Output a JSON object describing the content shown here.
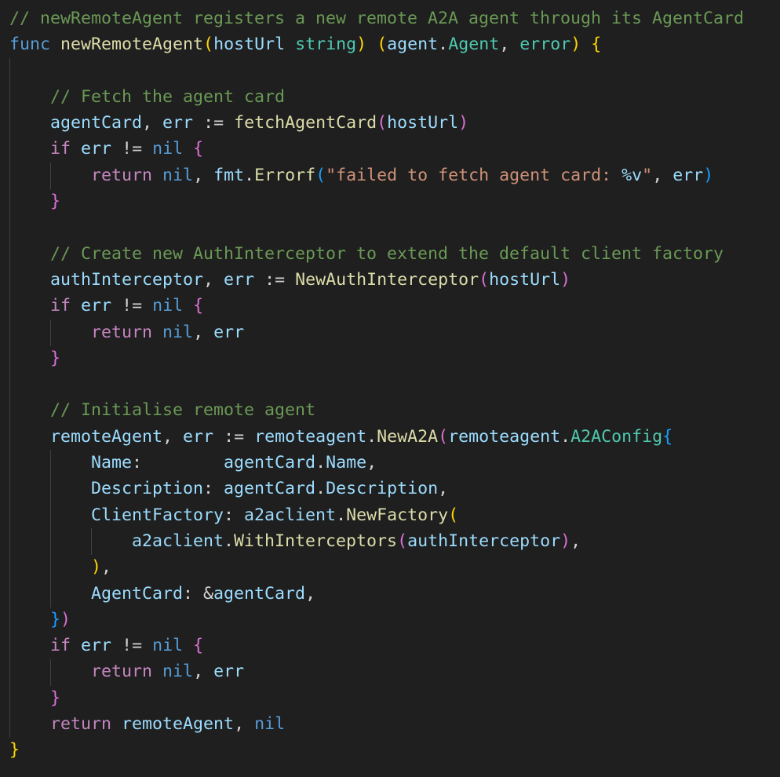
{
  "editor": {
    "theme_colors": {
      "background": "#1f1f1f",
      "comment": "#6a9955",
      "keyword": "#569cd6",
      "control": "#c586c0",
      "function": "#dcdcaa",
      "variable": "#9cdcfe",
      "type": "#4ec9b0",
      "string": "#ce9178",
      "format_specifier": "#9cdcfe",
      "plain": "#d4d4d4",
      "bracket_gold": "#ffd700",
      "bracket_purple": "#da70d6",
      "bracket_blue": "#179fff",
      "indent_guide": "#404040"
    },
    "lines": [
      [
        [
          "comment",
          "// newRemoteAgent registers a new remote A2A agent through its AgentCard"
        ]
      ],
      [
        [
          "keyword",
          "func"
        ],
        [
          "plain",
          " "
        ],
        [
          "function",
          "newRemoteAgent"
        ],
        [
          "bracket_gold",
          "("
        ],
        [
          "variable",
          "hostUrl"
        ],
        [
          "plain",
          " "
        ],
        [
          "type",
          "string"
        ],
        [
          "bracket_gold",
          ")"
        ],
        [
          "plain",
          " "
        ],
        [
          "bracket_gold",
          "("
        ],
        [
          "variable",
          "agent"
        ],
        [
          "plain",
          "."
        ],
        [
          "type",
          "Agent"
        ],
        [
          "plain",
          ", "
        ],
        [
          "type",
          "error"
        ],
        [
          "bracket_gold",
          ")"
        ],
        [
          "plain",
          " "
        ],
        [
          "bracket_gold",
          "{"
        ]
      ],
      [],
      [
        [
          "plain",
          "    "
        ],
        [
          "comment",
          "// Fetch the agent card"
        ]
      ],
      [
        [
          "plain",
          "    "
        ],
        [
          "variable",
          "agentCard"
        ],
        [
          "plain",
          ", "
        ],
        [
          "variable",
          "err"
        ],
        [
          "plain",
          " := "
        ],
        [
          "function",
          "fetchAgentCard"
        ],
        [
          "bracket_purple",
          "("
        ],
        [
          "variable",
          "hostUrl"
        ],
        [
          "bracket_purple",
          ")"
        ]
      ],
      [
        [
          "plain",
          "    "
        ],
        [
          "control",
          "if"
        ],
        [
          "plain",
          " "
        ],
        [
          "variable",
          "err"
        ],
        [
          "plain",
          " != "
        ],
        [
          "keyword",
          "nil"
        ],
        [
          "plain",
          " "
        ],
        [
          "bracket_purple",
          "{"
        ]
      ],
      [
        [
          "plain",
          "        "
        ],
        [
          "control",
          "return"
        ],
        [
          "plain",
          " "
        ],
        [
          "keyword",
          "nil"
        ],
        [
          "plain",
          ", "
        ],
        [
          "variable",
          "fmt"
        ],
        [
          "plain",
          "."
        ],
        [
          "function",
          "Errorf"
        ],
        [
          "bracket_blue",
          "("
        ],
        [
          "string",
          "\"failed to fetch agent card: "
        ],
        [
          "format_specifier",
          "%v"
        ],
        [
          "string",
          "\""
        ],
        [
          "plain",
          ", "
        ],
        [
          "variable",
          "err"
        ],
        [
          "bracket_blue",
          ")"
        ]
      ],
      [
        [
          "plain",
          "    "
        ],
        [
          "bracket_purple",
          "}"
        ]
      ],
      [],
      [
        [
          "plain",
          "    "
        ],
        [
          "comment",
          "// Create new AuthInterceptor to extend the default client factory"
        ]
      ],
      [
        [
          "plain",
          "    "
        ],
        [
          "variable",
          "authInterceptor"
        ],
        [
          "plain",
          ", "
        ],
        [
          "variable",
          "err"
        ],
        [
          "plain",
          " := "
        ],
        [
          "function",
          "NewAuthInterceptor"
        ],
        [
          "bracket_purple",
          "("
        ],
        [
          "variable",
          "hostUrl"
        ],
        [
          "bracket_purple",
          ")"
        ]
      ],
      [
        [
          "plain",
          "    "
        ],
        [
          "control",
          "if"
        ],
        [
          "plain",
          " "
        ],
        [
          "variable",
          "err"
        ],
        [
          "plain",
          " != "
        ],
        [
          "keyword",
          "nil"
        ],
        [
          "plain",
          " "
        ],
        [
          "bracket_purple",
          "{"
        ]
      ],
      [
        [
          "plain",
          "        "
        ],
        [
          "control",
          "return"
        ],
        [
          "plain",
          " "
        ],
        [
          "keyword",
          "nil"
        ],
        [
          "plain",
          ", "
        ],
        [
          "variable",
          "err"
        ]
      ],
      [
        [
          "plain",
          "    "
        ],
        [
          "bracket_purple",
          "}"
        ]
      ],
      [],
      [
        [
          "plain",
          "    "
        ],
        [
          "comment",
          "// Initialise remote agent"
        ]
      ],
      [
        [
          "plain",
          "    "
        ],
        [
          "variable",
          "remoteAgent"
        ],
        [
          "plain",
          ", "
        ],
        [
          "variable",
          "err"
        ],
        [
          "plain",
          " := "
        ],
        [
          "variable",
          "remoteagent"
        ],
        [
          "plain",
          "."
        ],
        [
          "function",
          "NewA2A"
        ],
        [
          "bracket_purple",
          "("
        ],
        [
          "variable",
          "remoteagent"
        ],
        [
          "plain",
          "."
        ],
        [
          "type",
          "A2AConfig"
        ],
        [
          "bracket_blue",
          "{"
        ]
      ],
      [
        [
          "plain",
          "        "
        ],
        [
          "variable",
          "Name"
        ],
        [
          "plain",
          ":        "
        ],
        [
          "variable",
          "agentCard"
        ],
        [
          "plain",
          "."
        ],
        [
          "variable",
          "Name"
        ],
        [
          "plain",
          ","
        ]
      ],
      [
        [
          "plain",
          "        "
        ],
        [
          "variable",
          "Description"
        ],
        [
          "plain",
          ": "
        ],
        [
          "variable",
          "agentCard"
        ],
        [
          "plain",
          "."
        ],
        [
          "variable",
          "Description"
        ],
        [
          "plain",
          ","
        ]
      ],
      [
        [
          "plain",
          "        "
        ],
        [
          "variable",
          "ClientFactory"
        ],
        [
          "plain",
          ": "
        ],
        [
          "variable",
          "a2aclient"
        ],
        [
          "plain",
          "."
        ],
        [
          "function",
          "NewFactory"
        ],
        [
          "bracket_gold",
          "("
        ]
      ],
      [
        [
          "plain",
          "            "
        ],
        [
          "variable",
          "a2aclient"
        ],
        [
          "plain",
          "."
        ],
        [
          "function",
          "WithInterceptors"
        ],
        [
          "bracket_purple",
          "("
        ],
        [
          "variable",
          "authInterceptor"
        ],
        [
          "bracket_purple",
          ")"
        ],
        [
          "plain",
          ","
        ]
      ],
      [
        [
          "plain",
          "        "
        ],
        [
          "bracket_gold",
          ")"
        ],
        [
          "plain",
          ","
        ]
      ],
      [
        [
          "plain",
          "        "
        ],
        [
          "variable",
          "AgentCard"
        ],
        [
          "plain",
          ": &"
        ],
        [
          "variable",
          "agentCard"
        ],
        [
          "plain",
          ","
        ]
      ],
      [
        [
          "plain",
          "    "
        ],
        [
          "bracket_blue",
          "}"
        ],
        [
          "bracket_purple",
          ")"
        ]
      ],
      [
        [
          "plain",
          "    "
        ],
        [
          "control",
          "if"
        ],
        [
          "plain",
          " "
        ],
        [
          "variable",
          "err"
        ],
        [
          "plain",
          " != "
        ],
        [
          "keyword",
          "nil"
        ],
        [
          "plain",
          " "
        ],
        [
          "bracket_purple",
          "{"
        ]
      ],
      [
        [
          "plain",
          "        "
        ],
        [
          "control",
          "return"
        ],
        [
          "plain",
          " "
        ],
        [
          "keyword",
          "nil"
        ],
        [
          "plain",
          ", "
        ],
        [
          "variable",
          "err"
        ]
      ],
      [
        [
          "plain",
          "    "
        ],
        [
          "bracket_purple",
          "}"
        ]
      ],
      [
        [
          "plain",
          "    "
        ],
        [
          "control",
          "return"
        ],
        [
          "plain",
          " "
        ],
        [
          "variable",
          "remoteAgent"
        ],
        [
          "plain",
          ", "
        ],
        [
          "keyword",
          "nil"
        ]
      ],
      [
        [
          "bracket_gold",
          "}"
        ]
      ]
    ]
  }
}
